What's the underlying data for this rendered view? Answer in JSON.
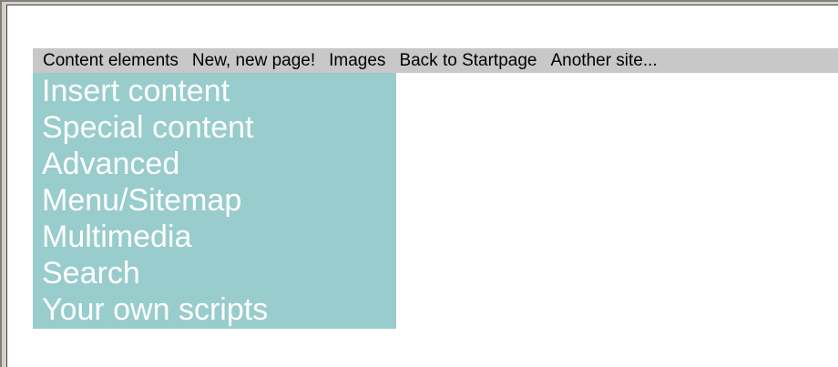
{
  "menubar": {
    "items": [
      {
        "label": "Content elements"
      },
      {
        "label": "New, new page!"
      },
      {
        "label": "Images"
      },
      {
        "label": "Back to Startpage"
      },
      {
        "label": "Another site..."
      }
    ]
  },
  "submenu": {
    "items": [
      {
        "label": "Insert content"
      },
      {
        "label": "Special content"
      },
      {
        "label": "Advanced"
      },
      {
        "label": "Menu/Sitemap"
      },
      {
        "label": "Multimedia"
      },
      {
        "label": "Search"
      },
      {
        "label": "Your own scripts"
      }
    ]
  },
  "colors": {
    "menubar_bg": "#c8c8c8",
    "submenu_bg": "#99cccc",
    "submenu_text": "#ffffff",
    "page_bg": "#ffffff"
  }
}
